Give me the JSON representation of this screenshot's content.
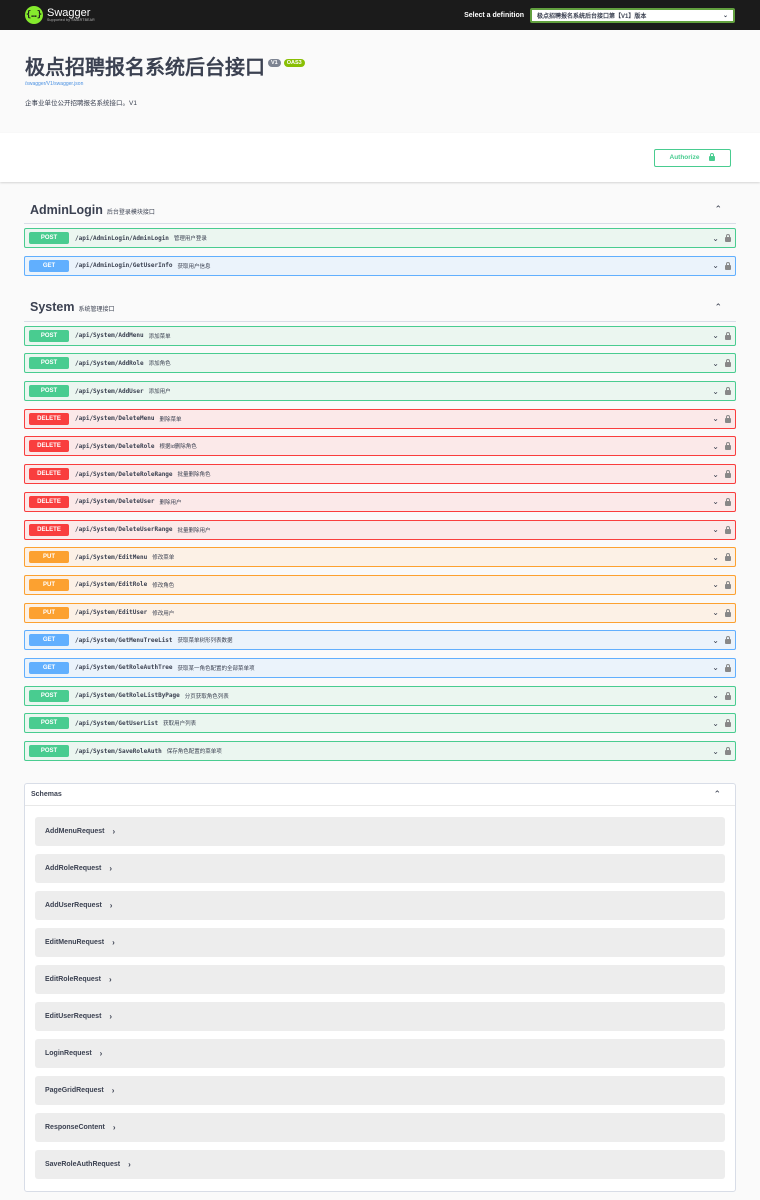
{
  "topbar": {
    "brand_name": "Swagger",
    "brand_sub": "Supported by SMARTBEAR",
    "logo_glyph": "{…}",
    "definition_label": "Select a definition",
    "definition_value": "极点招聘报名系统后台接口第【V1】版本"
  },
  "info": {
    "title": "极点招聘报名系统后台接口",
    "version_badge": "V1",
    "oas_badge": "OAS3",
    "spec_link": "/swagger/V1/swagger.json",
    "description": "企事业单位公开招聘报名系统接口。V1"
  },
  "auth": {
    "authorize_label": "Authorize"
  },
  "tags": [
    {
      "name": "AdminLogin",
      "description": "后台登录模块接口",
      "operations": [
        {
          "method": "POST",
          "path": "/api/AdminLogin/AdminLogin",
          "summary": "管理用户登录"
        },
        {
          "method": "GET",
          "path": "/api/AdminLogin/GetUserInfo",
          "summary": "获取用户信息"
        }
      ]
    },
    {
      "name": "System",
      "description": "系统管理接口",
      "operations": [
        {
          "method": "POST",
          "path": "/api/System/AddMenu",
          "summary": "添加菜单"
        },
        {
          "method": "POST",
          "path": "/api/System/AddRole",
          "summary": "添加角色"
        },
        {
          "method": "POST",
          "path": "/api/System/AddUser",
          "summary": "添加用户"
        },
        {
          "method": "DELETE",
          "path": "/api/System/DeleteMenu",
          "summary": "删除菜单"
        },
        {
          "method": "DELETE",
          "path": "/api/System/DeleteRole",
          "summary": "根据id删除角色"
        },
        {
          "method": "DELETE",
          "path": "/api/System/DeleteRoleRange",
          "summary": "批量删除角色"
        },
        {
          "method": "DELETE",
          "path": "/api/System/DeleteUser",
          "summary": "删除用户"
        },
        {
          "method": "DELETE",
          "path": "/api/System/DeleteUserRange",
          "summary": "批量删除用户"
        },
        {
          "method": "PUT",
          "path": "/api/System/EditMenu",
          "summary": "修改菜单"
        },
        {
          "method": "PUT",
          "path": "/api/System/EditRole",
          "summary": "修改角色"
        },
        {
          "method": "PUT",
          "path": "/api/System/EditUser",
          "summary": "修改用户"
        },
        {
          "method": "GET",
          "path": "/api/System/GetMenuTreeList",
          "summary": "获取菜单树形列表数据"
        },
        {
          "method": "GET",
          "path": "/api/System/GetRoleAuthTree",
          "summary": "获取某一角色配置的全部菜单项"
        },
        {
          "method": "POST",
          "path": "/api/System/GetRoleListByPage",
          "summary": "分页获取角色列表"
        },
        {
          "method": "POST",
          "path": "/api/System/GetUserList",
          "summary": "获取用户列表"
        },
        {
          "method": "POST",
          "path": "/api/System/SaveRoleAuth",
          "summary": "保存角色配置的菜单项"
        }
      ]
    }
  ],
  "schemas": {
    "title": "Schemas",
    "models": [
      "AddMenuRequest",
      "AddRoleRequest",
      "AddUserRequest",
      "EditMenuRequest",
      "EditRoleRequest",
      "EditUserRequest",
      "LoginRequest",
      "PageGridRequest",
      "ResponseContent",
      "SaveRoleAuthRequest"
    ]
  },
  "icons": {
    "expand": "chevron-down-icon",
    "collapse": "chevron-up-icon",
    "lock": "lock-icon",
    "model_expand": "chevron-right-icon"
  },
  "colors": {
    "post": "#49cc90",
    "get": "#61affe",
    "delete": "#f93e3e",
    "put": "#fca130",
    "topbar": "#1b1b1b",
    "brand": "#85ea2d"
  }
}
